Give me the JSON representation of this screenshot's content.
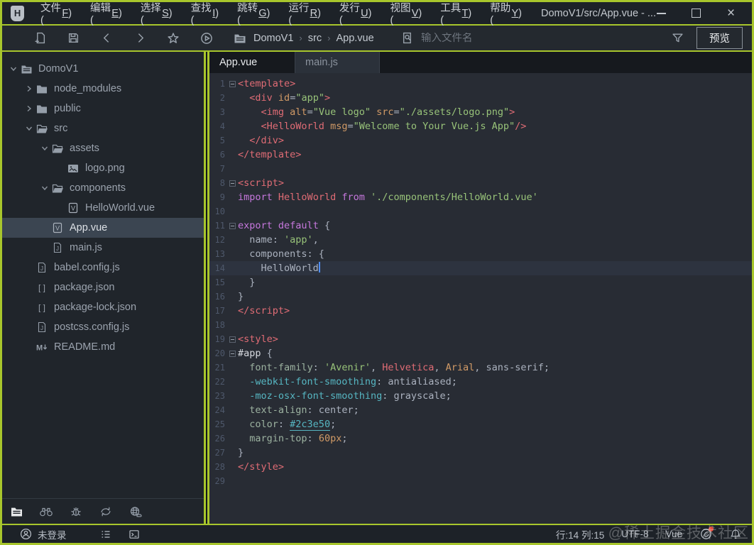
{
  "window": {
    "logo_letter": "H",
    "title": "DomoV1/src/App.vue - ...",
    "control_icons": [
      "minimize-icon",
      "maximize-icon",
      "close-icon"
    ]
  },
  "menu": {
    "items": [
      "文件(F)",
      "编辑(E)",
      "选择(S)",
      "查找(I)",
      "跳转(G)",
      "运行(R)",
      "发行(U)",
      "视图(V)",
      "工具(T)",
      "帮助(Y)"
    ]
  },
  "toolbar": {
    "icons": [
      "new-file-icon",
      "save-icon",
      "back-icon",
      "forward-icon",
      "star-icon",
      "run-icon"
    ],
    "breadcrumb_icon": "project-folder-icon",
    "breadcrumb": [
      "DomoV1",
      "src",
      "App.vue"
    ],
    "search_icon": "file-search-icon",
    "search_placeholder": "输入文件名",
    "filter_icon": "funnel-icon",
    "preview_label": "预览"
  },
  "sidebar": {
    "tree": [
      {
        "label": "DomoV1",
        "icon": "project-folder-icon",
        "arrow": "open",
        "level": 0
      },
      {
        "label": "node_modules",
        "icon": "folder-icon",
        "arrow": "closed",
        "level": 1
      },
      {
        "label": "public",
        "icon": "folder-icon",
        "arrow": "closed",
        "level": 1
      },
      {
        "label": "src",
        "icon": "folder-open-icon",
        "arrow": "open",
        "level": 1
      },
      {
        "label": "assets",
        "icon": "folder-open-icon",
        "arrow": "open",
        "level": 2
      },
      {
        "label": "logo.png",
        "icon": "image-file-icon",
        "arrow": "none",
        "level": 3
      },
      {
        "label": "components",
        "icon": "folder-open-icon",
        "arrow": "open",
        "level": 2
      },
      {
        "label": "HelloWorld.vue",
        "icon": "vue-file-icon",
        "arrow": "none",
        "level": 3
      },
      {
        "label": "App.vue",
        "icon": "vue-file-icon",
        "arrow": "none",
        "level": 2,
        "selected": true
      },
      {
        "label": "main.js",
        "icon": "js-file-icon",
        "arrow": "none",
        "level": 2
      },
      {
        "label": "babel.config.js",
        "icon": "js-file-icon",
        "arrow": "none",
        "level": 1
      },
      {
        "label": "package.json",
        "icon": "json-file-icon",
        "arrow": "none",
        "level": 1
      },
      {
        "label": "package-lock.json",
        "icon": "json-file-icon",
        "arrow": "none",
        "level": 1
      },
      {
        "label": "postcss.config.js",
        "icon": "js-file-icon",
        "arrow": "none",
        "level": 1
      },
      {
        "label": "README.md",
        "icon": "md-file-icon",
        "arrow": "none",
        "level": 1
      }
    ],
    "bottom_icons": [
      "files-panel-icon",
      "binoculars-icon",
      "bug-icon",
      "sync-icon",
      "globe-icon"
    ]
  },
  "tabs": [
    {
      "label": "App.vue",
      "active": true
    },
    {
      "label": "main.js",
      "active": false
    }
  ],
  "editor": {
    "cursor": {
      "line": 14,
      "col": 15
    },
    "lines": [
      {
        "n": 1,
        "fold": true,
        "t": [
          [
            "g",
            "<template>"
          ]
        ]
      },
      {
        "n": 2,
        "t": [
          [
            "p",
            "  "
          ],
          [
            "g",
            "<div"
          ],
          [
            "p",
            " "
          ],
          [
            "a",
            "id"
          ],
          [
            "p",
            "="
          ],
          [
            "s",
            "\"app\""
          ],
          [
            "g",
            ">"
          ]
        ]
      },
      {
        "n": 3,
        "t": [
          [
            "p",
            "    "
          ],
          [
            "g",
            "<img"
          ],
          [
            "p",
            " "
          ],
          [
            "a",
            "alt"
          ],
          [
            "p",
            "="
          ],
          [
            "s",
            "\"Vue logo\""
          ],
          [
            "p",
            " "
          ],
          [
            "a",
            "src"
          ],
          [
            "p",
            "="
          ],
          [
            "s",
            "\"./assets/logo.png\""
          ],
          [
            "g",
            ">"
          ]
        ]
      },
      {
        "n": 4,
        "t": [
          [
            "p",
            "    "
          ],
          [
            "g",
            "<HelloWorld"
          ],
          [
            "p",
            " "
          ],
          [
            "a",
            "msg"
          ],
          [
            "p",
            "="
          ],
          [
            "s",
            "\"Welcome to Your Vue.js App\""
          ],
          [
            "g",
            "/>"
          ]
        ]
      },
      {
        "n": 5,
        "t": [
          [
            "p",
            "  "
          ],
          [
            "g",
            "</div>"
          ]
        ]
      },
      {
        "n": 6,
        "t": [
          [
            "g",
            "</template>"
          ]
        ]
      },
      {
        "n": 7,
        "t": []
      },
      {
        "n": 8,
        "fold": true,
        "t": [
          [
            "g",
            "<script>"
          ]
        ]
      },
      {
        "n": 9,
        "t": [
          [
            "k",
            "import"
          ],
          [
            "p",
            " "
          ],
          [
            "r",
            "HelloWorld"
          ],
          [
            "p",
            " "
          ],
          [
            "k",
            "from"
          ],
          [
            "p",
            " "
          ],
          [
            "s",
            "'./components/HelloWorld.vue'"
          ]
        ]
      },
      {
        "n": 10,
        "t": []
      },
      {
        "n": 11,
        "fold": true,
        "t": [
          [
            "k",
            "export"
          ],
          [
            "p",
            " "
          ],
          [
            "k",
            "default"
          ],
          [
            "p",
            " {"
          ]
        ]
      },
      {
        "n": 12,
        "t": [
          [
            "p",
            "  name: "
          ],
          [
            "s",
            "'app'"
          ],
          [
            "p",
            ","
          ]
        ]
      },
      {
        "n": 13,
        "t": [
          [
            "p",
            "  components: {"
          ]
        ]
      },
      {
        "n": 14,
        "current": true,
        "cursor": true,
        "t": [
          [
            "p",
            "    HelloWorld"
          ]
        ]
      },
      {
        "n": 15,
        "t": [
          [
            "p",
            "  }"
          ]
        ]
      },
      {
        "n": 16,
        "t": [
          [
            "p",
            "}"
          ]
        ]
      },
      {
        "n": 17,
        "t": [
          [
            "g",
            "</script>"
          ]
        ]
      },
      {
        "n": 18,
        "t": []
      },
      {
        "n": 19,
        "fold": true,
        "t": [
          [
            "g",
            "<style>"
          ]
        ]
      },
      {
        "n": 20,
        "fold": true,
        "t": [
          [
            "b",
            "#app"
          ],
          [
            "p",
            " {"
          ]
        ]
      },
      {
        "n": 21,
        "t": [
          [
            "p",
            "  "
          ],
          [
            "pr",
            "font-family"
          ],
          [
            "p",
            ": "
          ],
          [
            "s",
            "'Avenir'"
          ],
          [
            "p",
            ", "
          ],
          [
            "r",
            "Helvetica"
          ],
          [
            "p",
            ", "
          ],
          [
            "a",
            "Arial"
          ],
          [
            "p",
            ", sans-serif;"
          ]
        ]
      },
      {
        "n": 22,
        "t": [
          [
            "p",
            "  "
          ],
          [
            "c",
            "-webkit-font-smoothing"
          ],
          [
            "p",
            ": antialiased;"
          ]
        ]
      },
      {
        "n": 23,
        "t": [
          [
            "p",
            "  "
          ],
          [
            "c",
            "-moz-osx-font-smoothing"
          ],
          [
            "p",
            ": grayscale;"
          ]
        ]
      },
      {
        "n": 24,
        "t": [
          [
            "p",
            "  "
          ],
          [
            "pr",
            "text-align"
          ],
          [
            "p",
            ": center;"
          ]
        ]
      },
      {
        "n": 25,
        "t": [
          [
            "p",
            "  "
          ],
          [
            "pr",
            "color"
          ],
          [
            "p",
            ": "
          ],
          [
            "cu",
            "#2c3e50"
          ],
          [
            "p",
            ";"
          ]
        ]
      },
      {
        "n": 26,
        "t": [
          [
            "p",
            "  "
          ],
          [
            "pr",
            "margin-top"
          ],
          [
            "p",
            ": "
          ],
          [
            "n",
            "60px"
          ],
          [
            "p",
            ";"
          ]
        ]
      },
      {
        "n": 27,
        "t": [
          [
            "p",
            "}"
          ]
        ]
      },
      {
        "n": 28,
        "t": [
          [
            "g",
            "</style>"
          ]
        ]
      },
      {
        "n": 29,
        "t": []
      }
    ]
  },
  "statusbar": {
    "login_icon": "account-icon",
    "login_label": "未登录",
    "icons": [
      "task-list-icon",
      "terminal-icon",
      "community-icon",
      "bell-icon"
    ],
    "line_col": "行:14  列:15",
    "encoding": "UTF-8",
    "language": "Vue"
  },
  "watermark": "@稀土掘金技术社区",
  "colors": {
    "annotation_border": "#a8c62c",
    "titlebar_bg": "#1d2228",
    "toolbar_bg": "#24292f",
    "sidebar_bg": "#20252b",
    "sidebar_selected_bg": "#3b4551",
    "editor_bg": "#282c34",
    "tabbar_bg": "#16191e",
    "syntax_tag": "#e06c75",
    "syntax_attr": "#d19a66",
    "syntax_string": "#98c379",
    "syntax_keyword": "#c678dd",
    "syntax_cyan": "#56b6c2",
    "cursor_blue": "#4f8ef7",
    "status_red_dot": "#e2493b"
  }
}
